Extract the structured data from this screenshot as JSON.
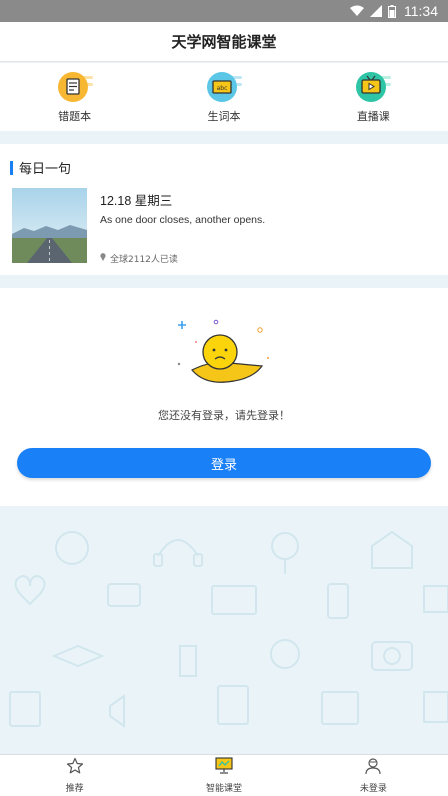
{
  "status": {
    "time": "11:34"
  },
  "header": {
    "title": "天学网智能课堂"
  },
  "quick_nav": [
    {
      "label": "错题本",
      "icon": "notebook-icon",
      "color": "#f7b733"
    },
    {
      "label": "生词本",
      "icon": "vocab-card-icon",
      "color": "#f5c518"
    },
    {
      "label": "直播课",
      "icon": "live-tv-icon",
      "color": "#2ec4a6"
    }
  ],
  "daily": {
    "heading": "每日一句",
    "date": "12.18 星期三",
    "quote": "As one door closes, another opens.",
    "reads": "全球2112人已读"
  },
  "login": {
    "prompt": "您还没有登录，请先登录！",
    "button": "登录"
  },
  "tabs": [
    {
      "label": "推荐",
      "icon": "star-icon"
    },
    {
      "label": "智能课堂",
      "icon": "classroom-board-icon"
    },
    {
      "label": "未登录",
      "icon": "user-icon"
    }
  ],
  "colors": {
    "accent": "#1a80f7",
    "background": "#eaf4f8"
  }
}
